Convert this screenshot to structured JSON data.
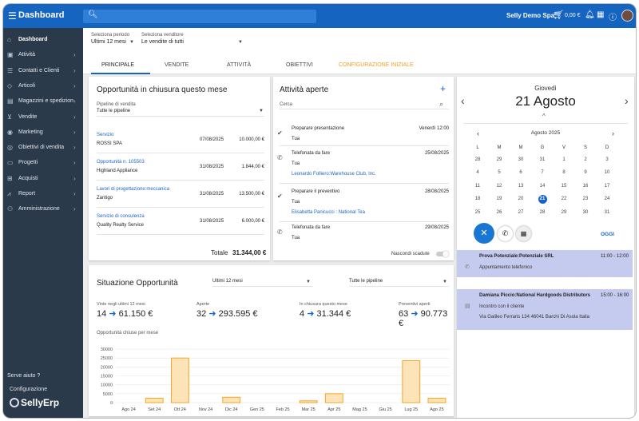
{
  "topbar": {
    "title": "Dashboard",
    "company": "Selly Demo Spa",
    "cart_amount": "0,00 €",
    "icons": [
      "menu-icon",
      "search-icon",
      "cart-icon",
      "bell-icon",
      "calendar-icon",
      "help-icon",
      "avatar"
    ]
  },
  "sidebar": {
    "items": [
      {
        "icon": "home-icon",
        "glyph": "⌂",
        "label": "Dashboard",
        "active": true
      },
      {
        "icon": "activity-icon",
        "glyph": "▣",
        "label": "Attività"
      },
      {
        "icon": "contacts-icon",
        "glyph": "☰",
        "label": "Contatti e Clienti"
      },
      {
        "icon": "tag-icon",
        "glyph": "◇",
        "label": "Articoli"
      },
      {
        "icon": "warehouse-icon",
        "glyph": "▤",
        "label": "Magazzini e spedizion"
      },
      {
        "icon": "cart-icon",
        "glyph": "⊻",
        "label": "Vendite"
      },
      {
        "icon": "megaphone-icon",
        "glyph": "◉",
        "label": "Marketing"
      },
      {
        "icon": "target-icon",
        "glyph": "◎",
        "label": "Obiettivi di vendita"
      },
      {
        "icon": "folder-icon",
        "glyph": "▭",
        "label": "Progetti"
      },
      {
        "icon": "bag-icon",
        "glyph": "⊞",
        "label": "Acquisti"
      },
      {
        "icon": "chart-icon",
        "glyph": "⩘",
        "label": "Report"
      },
      {
        "icon": "users-icon",
        "glyph": "⚇",
        "label": "Amministrazione"
      }
    ],
    "help": "Serve aiuto ?",
    "config": "Configurazione",
    "logo": "SellyErp"
  },
  "filters": {
    "period_label": "Seleziona periodo",
    "period_value": "Ultimi 12 mesi",
    "seller_label": "Seleziona venditore",
    "seller_value": "Le vendite di tutti"
  },
  "tabs": [
    "PRINCIPALE",
    "VENDITE",
    "ATTIVITÀ",
    "OBIETTIVI",
    "CONFIGURAZIONE INIZIALE"
  ],
  "opportunities": {
    "title": "Opportunità in chiusura questo mese",
    "pipeline_label": "Pipeline di vendita",
    "pipeline_value": "Tutte le pipeline",
    "rows": [
      {
        "name": "Servizio",
        "company": "ROSSI SPA",
        "date": "07/08/2025",
        "amount": "10.000,00 €"
      },
      {
        "name": "Opportunità n. 105503",
        "company": "Highland Appliance",
        "date": "31/08/2025",
        "amount": "1.844,00 €"
      },
      {
        "name": "Lavori di progettazione:meccanica",
        "company": "Zantigo",
        "date": "31/08/2025",
        "amount": "13.500,00 €"
      },
      {
        "name": "Servizio di consulenza",
        "company": "Quality Realty Service",
        "date": "31/08/2025",
        "amount": "6.000,00 €"
      }
    ],
    "total_label": "Totale",
    "total_value": "31.344,00 €"
  },
  "activities": {
    "title": "Attività aperte",
    "search_placeholder": "Cerca",
    "hide_label": "Nascondi scadute",
    "rows": [
      {
        "icon": "check-icon",
        "glyph": "✔",
        "title": "Preparare presentazione",
        "date": "Venerdì 12:00",
        "owner": "Tua",
        "link": ""
      },
      {
        "icon": "phone-icon",
        "glyph": "✆",
        "title": "Telefonata da fare",
        "date": "25/08/2025",
        "owner": "Tua",
        "link": "Leonardo Folliero:Warehouse Club, Inc."
      },
      {
        "icon": "check-icon",
        "glyph": "✔",
        "title": "Preparare il preventivo",
        "date": "28/08/2025",
        "owner": "Tua",
        "link": "Elisabetta Panicucci : National Tea"
      },
      {
        "icon": "phone-icon",
        "glyph": "✆",
        "title": "Telefonata da fare",
        "date": "29/08/2025",
        "owner": "Tua",
        "link": ""
      }
    ]
  },
  "calendar": {
    "weekday": "Giovedì",
    "date": "21 Agosto",
    "month": "Agosto 2025",
    "today_btn": "OGGI",
    "headers": [
      "L",
      "M",
      "M",
      "G",
      "V",
      "S",
      "D"
    ],
    "weeks": [
      [
        "28",
        "29",
        "30",
        "31",
        "1",
        "2",
        "3"
      ],
      [
        "4",
        "5",
        "6",
        "7",
        "8",
        "9",
        "10"
      ],
      [
        "11",
        "12",
        "13",
        "14",
        "15",
        "16",
        "17"
      ],
      [
        "18",
        "19",
        "20",
        "21",
        "22",
        "23",
        "24"
      ],
      [
        "25",
        "26",
        "27",
        "28",
        "29",
        "30",
        "31"
      ]
    ],
    "selected": "21",
    "appointments": [
      {
        "title": "Prova Potenziale:Potenziale SRL",
        "time": "11:00 - 12:00",
        "lines": [
          "Appuntamento telefonico"
        ]
      },
      {
        "title": "Damiana Piccio:National Hardgoods Distributors",
        "time": "15:00 - 16:00",
        "lines": [
          "Incontro con il cliente",
          "Via Galileo Ferraris 134 46041 Barchi Di Asola Italia"
        ]
      }
    ]
  },
  "situation": {
    "title": "Situazione Opportunità",
    "period": "Ultimi 12 mesi",
    "pipeline": "Tutte le pipeline",
    "kpis": [
      {
        "label": "Vinte negli ultimi 12 mesi",
        "count": "14",
        "value": "61.150 €"
      },
      {
        "label": "Aperte",
        "count": "32",
        "value": "293.595 €"
      },
      {
        "label": "In chiusura questo mese",
        "count": "4",
        "value": "31.344 €"
      },
      {
        "label": "Preventivi aperti",
        "count": "63",
        "value": "90.773 €"
      }
    ],
    "chart_title": "Opportunità chiuse per mese"
  },
  "chart_data": {
    "type": "bar",
    "categories": [
      "Ago 24",
      "Set 24",
      "Ott 24",
      "Nov 24",
      "Dic 24",
      "Gen 25",
      "Feb 25",
      "Mar 25",
      "Apr 25",
      "Mag 25",
      "Giu 25",
      "Lug 25",
      "Ago 25"
    ],
    "values": [
      0,
      2500,
      25000,
      0,
      3000,
      0,
      0,
      1000,
      5000,
      0,
      0,
      23500,
      2500
    ],
    "yticks": [
      0,
      5000,
      10000,
      15000,
      20000,
      25000,
      30000
    ],
    "ylim": [
      0,
      30000
    ],
    "color": "#f5a623",
    "fill": "#fde3b8"
  }
}
